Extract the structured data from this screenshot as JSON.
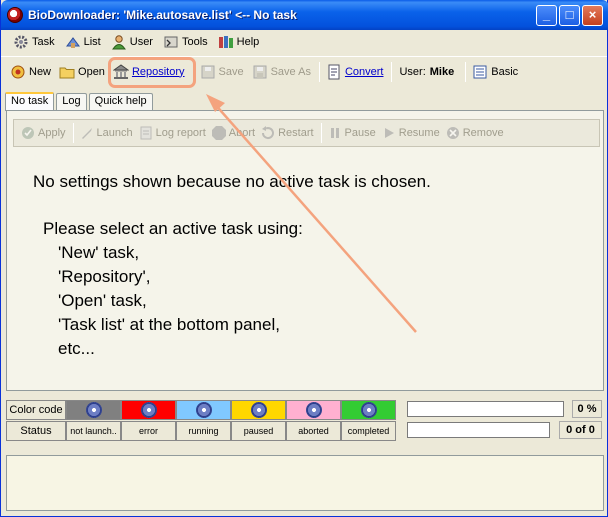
{
  "window": {
    "title": "BioDownloader: 'Mike.autosave.list' <-- No task",
    "minimize": "_",
    "maximize": "□",
    "close": "×"
  },
  "menu": [
    {
      "label": "Task",
      "icon": "task-icon"
    },
    {
      "label": "List",
      "icon": "list-icon"
    },
    {
      "label": "User",
      "icon": "user-icon"
    },
    {
      "label": "Tools",
      "icon": "tools-icon"
    },
    {
      "label": "Help",
      "icon": "help-icon"
    }
  ],
  "toolbar": {
    "new": "New",
    "open": "Open",
    "repository": "Repository",
    "save": "Save",
    "save_as": "Save As",
    "convert": "Convert",
    "user_label": "User:",
    "user_name": "Mike",
    "basic": "Basic"
  },
  "tabs": [
    "No task",
    "Log",
    "Quick help"
  ],
  "actions": {
    "apply": "Apply",
    "launch": "Launch",
    "log_report": "Log report",
    "abort": "Abort",
    "restart": "Restart",
    "pause": "Pause",
    "resume": "Resume",
    "remove": "Remove"
  },
  "message": {
    "line1": "No settings shown because no active task is chosen.",
    "line2": "Please select an active task using:",
    "line3": "'New' task,",
    "line4": "'Repository',",
    "line5": "'Open' task,",
    "line6": "'Task list' at the bottom panel,",
    "line7": "etc..."
  },
  "status": {
    "color_code_label": "Color code",
    "status_label": "Status",
    "states": [
      {
        "label": "not launch..",
        "color": "#808080"
      },
      {
        "label": "error",
        "color": "#ff0000"
      },
      {
        "label": "running",
        "color": "#80c8ff"
      },
      {
        "label": "paused",
        "color": "#ffd700"
      },
      {
        "label": "aborted",
        "color": "#ffb0d0"
      },
      {
        "label": "completed",
        "color": "#33cc33"
      }
    ],
    "percent": "0 %",
    "count": "0 of 0"
  },
  "colors": {
    "highlight": "#f4a37e",
    "link": "#0000cc",
    "title_bar": "#0a5ce8"
  }
}
